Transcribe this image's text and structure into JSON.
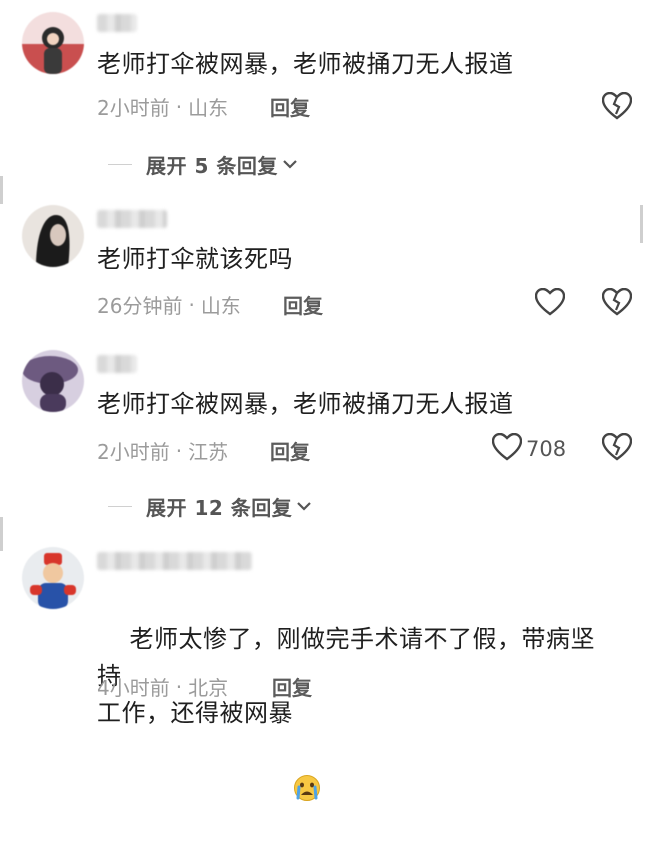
{
  "comments": [
    {
      "text": "老师打伞被网暴，老师被捅刀无人报道",
      "time": "2小时前",
      "location": "山东",
      "reply_label": "回复",
      "avatar_colors": [
        "#f2d6d6",
        "#c94f4f",
        "#2b2b2b"
      ]
    },
    {
      "text": "老师打伞就该死吗",
      "time": "26分钟前",
      "location": "山东",
      "reply_label": "回复",
      "avatar_colors": [
        "#e9e4df",
        "#1b1b1b",
        "#b8aaa0"
      ]
    },
    {
      "text": "老师打伞被网暴，老师被捅刀无人报道",
      "time": "2小时前",
      "location": "江苏",
      "reply_label": "回复",
      "like_count": "708",
      "avatar_colors": [
        "#6d5a80",
        "#3b2e49",
        "#d7cfe0"
      ]
    },
    {
      "text": "老师太惨了，刚做完手术请不了假，带病坚持\n工作，还得被网暴",
      "time": "4小时前",
      "location": "北京",
      "reply_label": "回复",
      "avatar_colors": [
        "#e9ecef",
        "#d8362b",
        "#2852a8"
      ]
    }
  ],
  "expand": [
    {
      "label": "展开 5 条回复"
    },
    {
      "label": "展开 12 条回复"
    }
  ],
  "separator": "·",
  "colors": {
    "text": "#1f1f1f",
    "meta": "#9b9b9b",
    "icon": "#444444"
  }
}
